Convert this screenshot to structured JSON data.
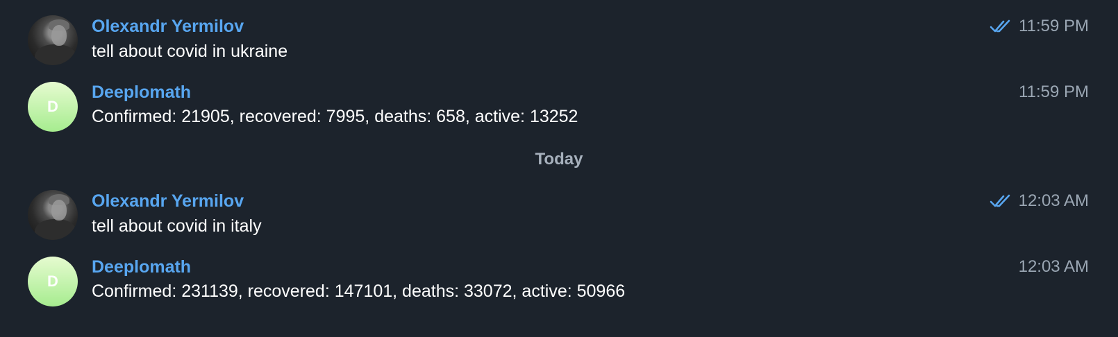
{
  "messages": [
    {
      "sender": "Olexandr Yermilov",
      "text": "tell about covid in ukraine",
      "time": "11:59 PM",
      "read": true,
      "avatar": "user-photo"
    },
    {
      "sender": "Deeplomath",
      "text": "Confirmed: 21905, recovered: 7995, deaths: 658, active: 13252",
      "time": "11:59 PM",
      "read": false,
      "avatar_initial": "D"
    },
    {
      "sender": "Olexandr Yermilov",
      "text": "tell about covid in italy",
      "time": "12:03 AM",
      "read": true,
      "avatar": "user-photo"
    },
    {
      "sender": "Deeplomath",
      "text": "Confirmed: 231139, recovered: 147101, deaths: 33072, active: 50966",
      "time": "12:03 AM",
      "read": false,
      "avatar_initial": "D"
    }
  ],
  "date_separator": "Today",
  "colors": {
    "background": "#1c232c",
    "sender_name": "#58a6f0",
    "message_text": "#ffffff",
    "timestamp": "#9aa6b3",
    "read_check": "#58a6f0",
    "bot_avatar_gradient": [
      "#e6fbd0",
      "#a6ec8f"
    ]
  }
}
